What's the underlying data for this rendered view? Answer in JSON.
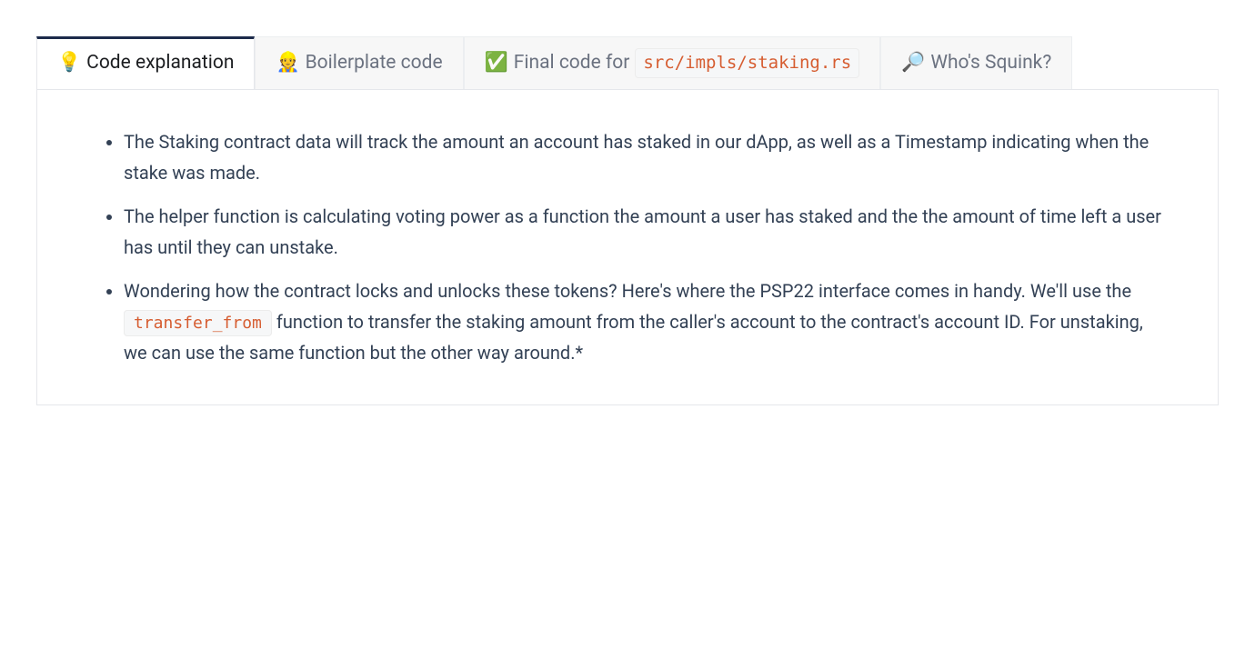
{
  "tabs": [
    {
      "icon": "💡",
      "label": "Code explanation",
      "active": true
    },
    {
      "icon": "👷",
      "label": "Boilerplate code",
      "active": false
    },
    {
      "icon": "✅",
      "label_prefix": "Final code for",
      "code": "src/impls/staking.rs",
      "active": false
    },
    {
      "icon": "🔎",
      "label": "Who's Squink?",
      "active": false
    }
  ],
  "panel": {
    "bullets": [
      {
        "text": "The Staking contract data will track the amount an account has staked in our dApp, as well as a Timestamp indicating when the stake was made."
      },
      {
        "text": "The helper function is calculating voting power as a function the amount a user has staked and the the amount of time left a user has until they can unstake."
      },
      {
        "pre": "Wondering how the contract locks and unlocks these tokens? Here's where the PSP22 interface comes in handy. We'll use the ",
        "code": "transfer_from",
        "post": " function to transfer the staking amount from the caller's account to the contract's account ID. For unstaking, we can use the same function but the other way around.*"
      }
    ]
  }
}
